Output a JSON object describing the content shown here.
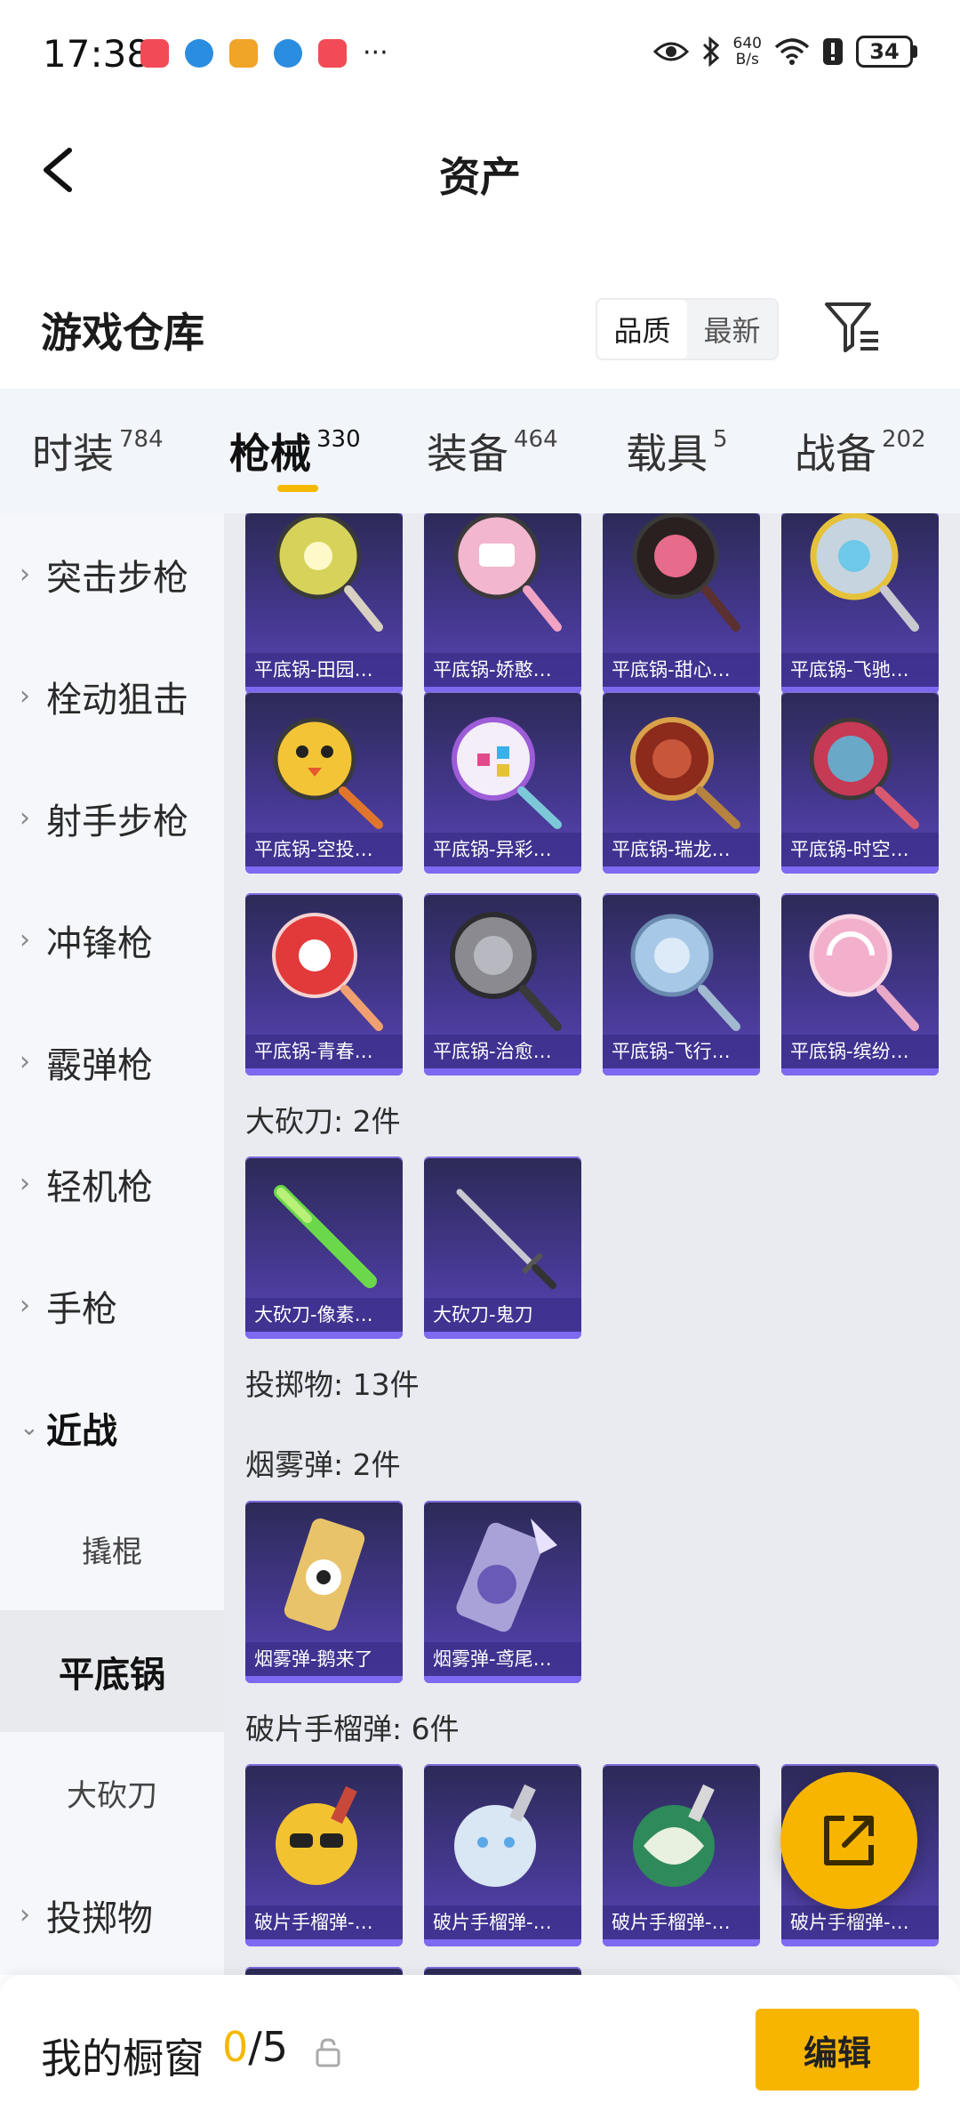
{
  "status_bar": {
    "time": "17:38",
    "net_speed": "640\nB/s",
    "net_speed_value": "640",
    "net_speed_unit": "B/s",
    "battery": "34",
    "more": "···"
  },
  "header": {
    "title": "资产"
  },
  "warehouse": {
    "title": "游戏仓库",
    "sort_options": [
      "品质",
      "最新"
    ]
  },
  "tabs": [
    {
      "label": "时装",
      "count": "784"
    },
    {
      "label": "枪械",
      "count": "330"
    },
    {
      "label": "装备",
      "count": "464"
    },
    {
      "label": "载具",
      "count": "5"
    },
    {
      "label": "战备",
      "count": "202"
    }
  ],
  "sidebar": {
    "categories": [
      "突击步枪",
      "栓动狙击",
      "射手步枪",
      "冲锋枪",
      "霰弹枪",
      "轻机枪",
      "手枪",
      "近战"
    ],
    "subcategories": [
      "撬棍",
      "平底锅",
      "大砍刀"
    ],
    "after": "投掷物"
  },
  "content": {
    "pan_rows": [
      [
        "平底锅-田园…",
        "平底锅-娇憨…",
        "平底锅-甜心…",
        "平底锅-飞驰…"
      ],
      [
        "平底锅-空投…",
        "平底锅-异彩…",
        "平底锅-瑞龙…",
        "平底锅-时空…"
      ],
      [
        "平底锅-青春…",
        "平底锅-治愈…",
        "平底锅-飞行…",
        "平底锅-缤纷…"
      ]
    ],
    "machete_title": "大砍刀: 2件",
    "machete_items": [
      "大砍刀-像素…",
      "大砍刀-鬼刀"
    ],
    "throwable_title": "投掷物: 13件",
    "smoke_title": "烟雾弹: 2件",
    "smoke_items": [
      "烟雾弹-鹅来了",
      "烟雾弹-鸢尾…"
    ],
    "frag_title": "破片手榴弹: 6件",
    "frag_items": [
      "破片手榴弹-…",
      "破片手榴弹-…",
      "破片手榴弹-…",
      "破片手榴弹-…"
    ]
  },
  "bottom_bar": {
    "title": "我的橱窗",
    "count_current": "0",
    "count_total": "/5",
    "edit_label": "编辑"
  },
  "colors": {
    "accent": "#f7b500",
    "card_bg": "#43378c",
    "content_bg": "#e9ebf1",
    "sidebar_bg": "#f6f7fb"
  }
}
